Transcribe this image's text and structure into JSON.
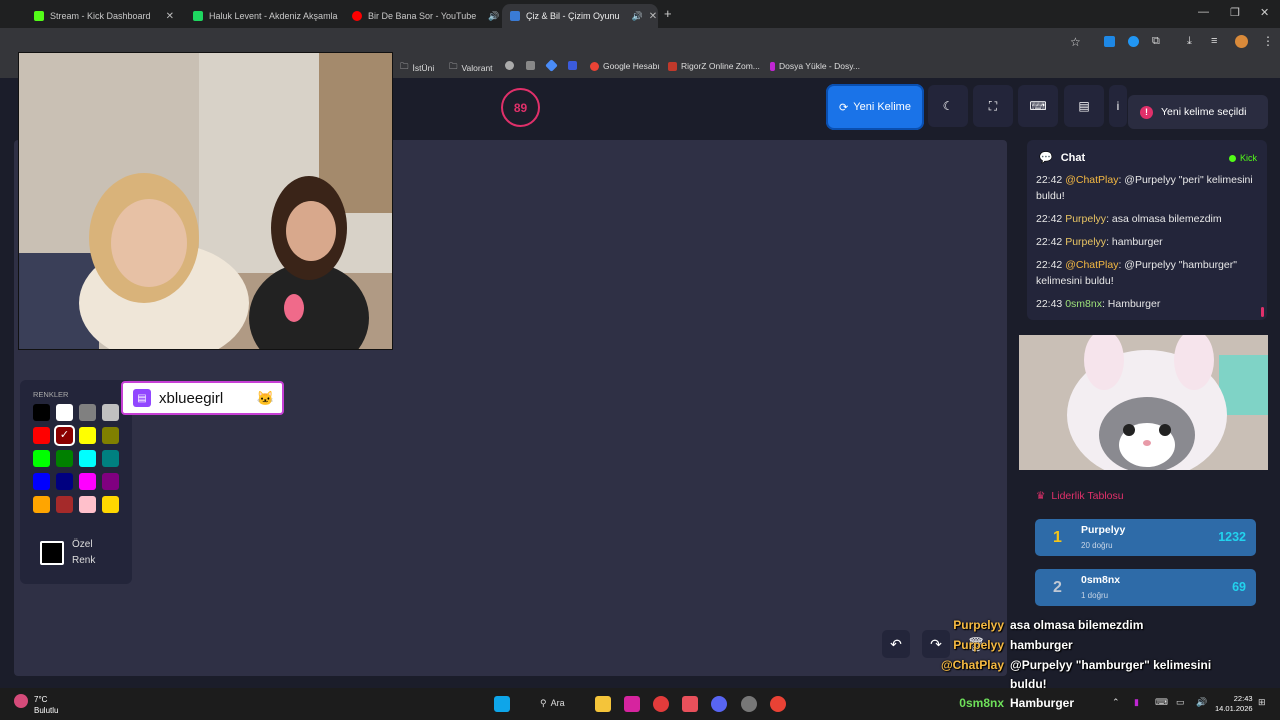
{
  "browser": {
    "tabs": [
      {
        "label": "Stream - Kick Dashboard",
        "color": "#53fc18"
      },
      {
        "label": "Haluk Levent - Akdeniz Akşamla",
        "color": "#1ed760"
      },
      {
        "label": "Bir De Bana Sor - YouTube",
        "color": "#ff0000"
      },
      {
        "label": "Çiz & Bil - Çizim Oyunu",
        "color": "#3a7bd5"
      }
    ],
    "bookmarks": [
      "İstÜni",
      "Valorant",
      "Google Hesabı",
      "RigorZ Online Zom...",
      "Dosya Yükle - Dosy..."
    ]
  },
  "game": {
    "timer": "89",
    "new_word_label": "Yeni Kelime",
    "toast": "Yeni kelime seçildi",
    "toolbar_icons": [
      "moon-icon",
      "fullscreen-icon",
      "keyboard-icon",
      "archive-icon"
    ]
  },
  "palette": {
    "title": "RENKLER",
    "colors": [
      "#000000",
      "#ffffff",
      "#808080",
      "#c0c0c0",
      "#ff0000",
      "#8b0000",
      "#ffff00",
      "#808000",
      "#00ff00",
      "#008000",
      "#00ffff",
      "#008080",
      "#0000ff",
      "#000080",
      "#ff00ff",
      "#800080",
      "#ffa500",
      "#a52a2a",
      "#ffc0cb",
      "#ffd700"
    ],
    "custom_label_1": "Özel",
    "custom_label_2": "Renk"
  },
  "nametag": "xblueegirl",
  "chat": {
    "title": "Chat",
    "platform": "Kick",
    "messages": [
      {
        "time": "22:42",
        "user": "@ChatPlay",
        "text": ": @Purpelyy \"peri\" kelimesini buldu!",
        "type": "bot"
      },
      {
        "time": "22:42",
        "user": "Purpelyy",
        "text": ": asa olmasa bilemezdim",
        "type": "p"
      },
      {
        "time": "22:42",
        "user": "Purpelyy",
        "text": ": hamburger",
        "type": "p"
      },
      {
        "time": "22:42",
        "user": "@ChatPlay",
        "text": ": @Purpelyy \"hamburger\" kelimesini buldu!",
        "type": "bot"
      },
      {
        "time": "22:43",
        "user": "0sm8nx",
        "text": ": Hamburger",
        "type": "o"
      }
    ]
  },
  "leaderboard": {
    "title": "Liderlik Tablosu",
    "rows": [
      {
        "rank": "1",
        "name": "Purpelyy",
        "sub": "20 doğru",
        "score": "1232"
      },
      {
        "rank": "2",
        "name": "0sm8nx",
        "sub": "1 doğru",
        "score": "69"
      }
    ]
  },
  "overlay_chat": [
    {
      "user": "Purpelyy",
      "text": "asa olmasa bilemezdim",
      "color": "#f5b942"
    },
    {
      "user": "Purpelyy",
      "text": "hamburger",
      "color": "#f5b942"
    },
    {
      "user": "@ChatPlay",
      "text": "@Purpelyy \"hamburger\" kelimesini",
      "color": "#f5b942"
    },
    {
      "user": "",
      "text": "buldu!",
      "color": "#f5b942"
    },
    {
      "user": "0sm8nx",
      "text": "Hamburger",
      "color": "#6ee05a"
    }
  ],
  "taskbar": {
    "weather_temp": "7°C",
    "weather_desc": "Bulutlu",
    "search": "Ara",
    "time": "22:43",
    "date": "14.01.2026"
  }
}
